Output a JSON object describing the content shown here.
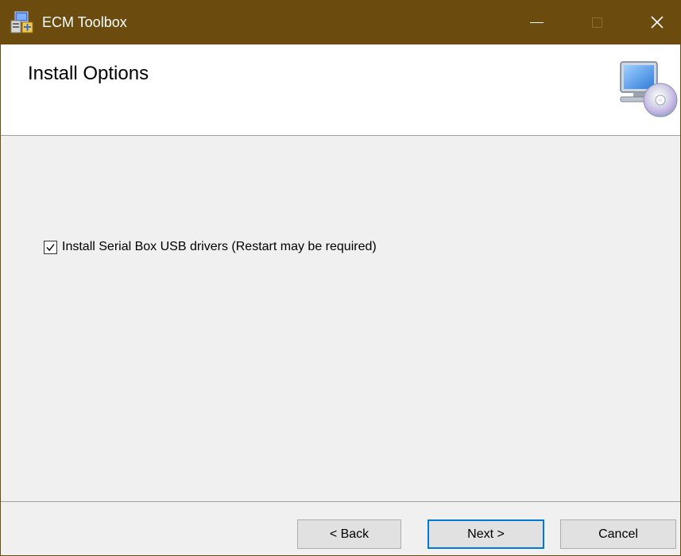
{
  "window": {
    "title": "ECM Toolbox",
    "titlebar_color": "#6b4b0e"
  },
  "header": {
    "title": "Install Options",
    "icon": "computer-cd-icon"
  },
  "options": {
    "usb_drivers": {
      "label": "Install Serial Box USB drivers (Restart may be required)",
      "checked": true
    }
  },
  "buttons": {
    "back": "< Back",
    "next": "Next >",
    "cancel": "Cancel"
  },
  "accent_color": "#0078d7"
}
